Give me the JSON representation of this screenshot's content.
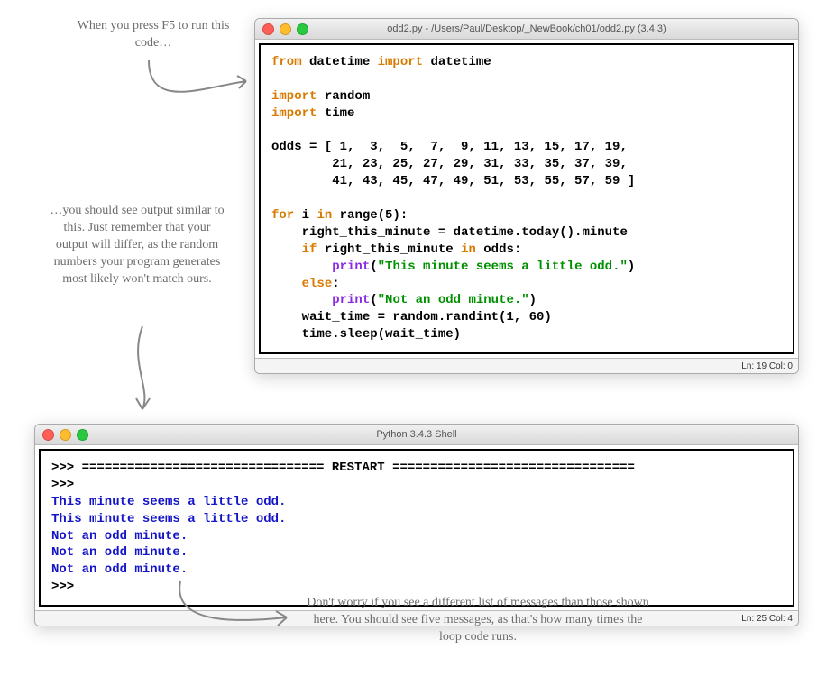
{
  "annotations": {
    "top": "When you press F5 to run this code…",
    "middle": "…you should see output similar to this. Just remember that your output will differ, as the random numbers your program generates most likely won't match ours.",
    "bottom": "Don't worry if you see a different list of messages than those shown here. You should see five messages, as that's how many times the loop code runs."
  },
  "editor": {
    "title": "odd2.py - /Users/Paul/Desktop/_NewBook/ch01/odd2.py (3.4.3)",
    "status": "Ln: 19 Col: 0",
    "code": {
      "l1a": "from",
      "l1b": " datetime ",
      "l1c": "import",
      "l1d": " datetime",
      "l3a": "import",
      "l3b": " random",
      "l4a": "import",
      "l4b": " time",
      "l6": "odds = [ 1,  3,  5,  7,  9, 11, 13, 15, 17, 19,",
      "l7": "        21, 23, 25, 27, 29, 31, 33, 35, 37, 39,",
      "l8": "        41, 43, 45, 47, 49, 51, 53, 55, 57, 59 ]",
      "l10a": "for",
      "l10b": " i ",
      "l10c": "in",
      "l10d": " range(5):",
      "l11": "    right_this_minute = datetime.today().minute",
      "l12a": "    ",
      "l12b": "if",
      "l12c": " right_this_minute ",
      "l12d": "in",
      "l12e": " odds:",
      "l13a": "        ",
      "l13b": "print",
      "l13c": "(",
      "l13d": "\"This minute seems a little odd.\"",
      "l13e": ")",
      "l14a": "    ",
      "l14b": "else",
      "l14c": ":",
      "l15a": "        ",
      "l15b": "print",
      "l15c": "(",
      "l15d": "\"Not an odd minute.\"",
      "l15e": ")",
      "l16": "    wait_time = random.randint(1, 60)",
      "l17": "    time.sleep(wait_time)"
    }
  },
  "shell": {
    "title": "Python 3.4.3 Shell",
    "status": "Ln: 25 Col: 4",
    "output": {
      "prompt": ">>> ",
      "restart": "================================ RESTART ================================",
      "line1": "This minute seems a little odd.",
      "line2": "This minute seems a little odd.",
      "line3": "Not an odd minute.",
      "line4": "Not an odd minute.",
      "line5": "Not an odd minute."
    }
  }
}
